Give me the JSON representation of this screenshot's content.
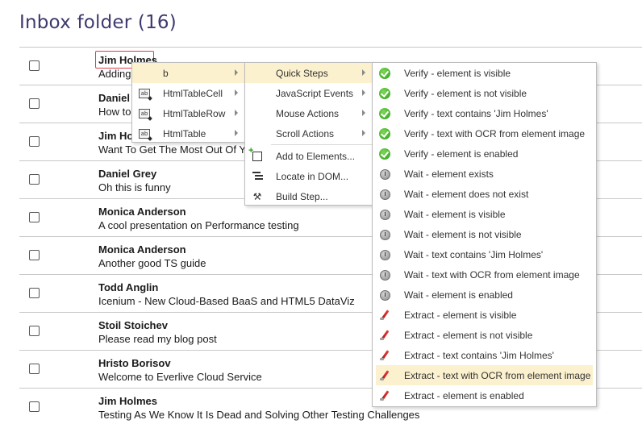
{
  "page": {
    "title": "Inbox folder (16)"
  },
  "emails": [
    {
      "sender": "Jim Holmes",
      "subject": "Adding"
    },
    {
      "sender": "Daniel",
      "subject": "How to"
    },
    {
      "sender": "Jim Ho",
      "subject": "Want To Get The Most Out Of Yo"
    },
    {
      "sender": "Daniel Grey",
      "subject": "Oh this is funny"
    },
    {
      "sender": "Monica Anderson",
      "subject": "A cool presentation on Performance testing"
    },
    {
      "sender": "Monica Anderson",
      "subject": "Another good TS guide"
    },
    {
      "sender": "Todd Anglin",
      "subject": "Icenium - New Cloud-Based BaaS and HTML5 DataViz"
    },
    {
      "sender": "Stoil Stoichev",
      "subject": "Please read my blog post"
    },
    {
      "sender": "Hristo Borisov",
      "subject": "Welcome to Everlive Cloud Service"
    },
    {
      "sender": "Jim Holmes",
      "subject": "Testing As We Know It Is Dead and Solving Other Testing Challenges"
    }
  ],
  "element_menu": {
    "items": [
      {
        "label": "b",
        "icon": "none",
        "selected": true
      },
      {
        "label": "HtmlTableCell",
        "icon": "table-cell-icon"
      },
      {
        "label": "HtmlTableRow",
        "icon": "table-row-icon"
      },
      {
        "label": "HtmlTable",
        "icon": "table-icon"
      }
    ]
  },
  "actions_menu": {
    "submenus": [
      {
        "label": "Quick Steps",
        "selected": true
      },
      {
        "label": "JavaScript Events"
      },
      {
        "label": "Mouse Actions"
      },
      {
        "label": "Scroll Actions"
      }
    ],
    "commands": [
      {
        "label": "Add to Elements...",
        "icon": "add-element-icon"
      },
      {
        "label": "Locate in DOM...",
        "icon": "locate-dom-icon"
      },
      {
        "label": "Build Step...",
        "icon": "build-step-icon"
      }
    ]
  },
  "quick_steps_menu": {
    "items": [
      {
        "label": "Verify - element is visible",
        "icon": "check-icon"
      },
      {
        "label": "Verify - element is not visible",
        "icon": "check-icon"
      },
      {
        "label": "Verify - text contains 'Jim Holmes'",
        "icon": "check-icon"
      },
      {
        "label": "Verify - text with OCR from element image",
        "icon": "check-icon"
      },
      {
        "label": "Verify - element is enabled",
        "icon": "check-icon"
      },
      {
        "label": "Wait - element exists",
        "icon": "clock-icon"
      },
      {
        "label": "Wait - element does not exist",
        "icon": "clock-icon"
      },
      {
        "label": "Wait - element is visible",
        "icon": "clock-icon"
      },
      {
        "label": "Wait - element is not visible",
        "icon": "clock-icon"
      },
      {
        "label": "Wait - text contains 'Jim Holmes'",
        "icon": "clock-icon"
      },
      {
        "label": "Wait - text with OCR from element image",
        "icon": "clock-icon"
      },
      {
        "label": "Wait - element is enabled",
        "icon": "clock-icon"
      },
      {
        "label": "Extract - element is visible",
        "icon": "extract-icon"
      },
      {
        "label": "Extract - element is not visible",
        "icon": "extract-icon"
      },
      {
        "label": "Extract - text contains 'Jim Holmes'",
        "icon": "extract-icon"
      },
      {
        "label": "Extract - text with OCR from element image",
        "icon": "extract-icon",
        "selected": true
      },
      {
        "label": "Extract - element is enabled",
        "icon": "extract-icon"
      }
    ]
  },
  "colors": {
    "title": "#3d3a6e",
    "selected_bg": "#fcf1cf",
    "highlight_border": "#e0394a"
  }
}
